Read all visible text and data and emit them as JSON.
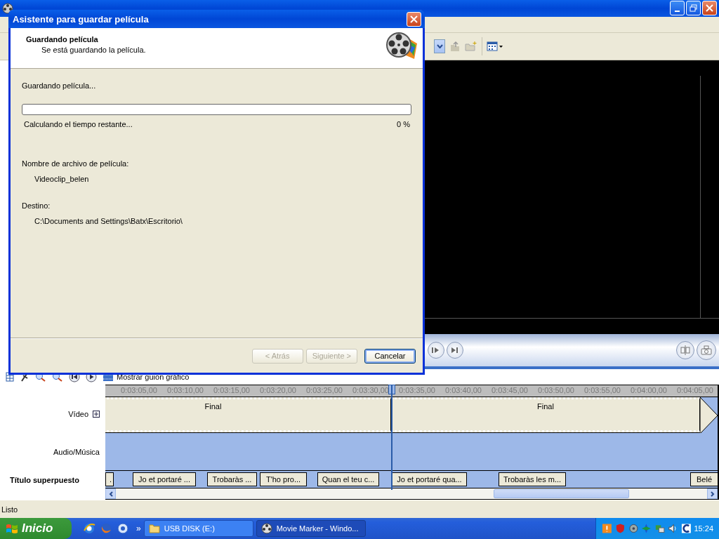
{
  "dialog": {
    "title": "Asistente para guardar película",
    "header": {
      "title": "Guardando película",
      "subtitle": "Se está guardando la película."
    },
    "progress_caption": "Guardando película...",
    "progress": {
      "level": 0
    },
    "status_text": "Calculando el tiempo restante...",
    "percent": "0 %",
    "fields": [
      {
        "label": "Nombre de archivo de película:",
        "value": "Videoclip_belen"
      },
      {
        "label": "Destino:",
        "value": "C:\\Documents and Settings\\Batx\\Escritorio\\"
      }
    ],
    "buttons": [
      {
        "label": "< Atrás",
        "disabled": true,
        "default": false
      },
      {
        "label": "Siguiente >",
        "disabled": true,
        "default": false
      },
      {
        "label": "Cancelar",
        "disabled": false,
        "default": true
      }
    ]
  },
  "timeline": {
    "toolbar_label": "Mostrar guion gráfico",
    "ruler": [
      "0:03:05,00",
      "0:03:10,00",
      "0:03:15,00",
      "0:03:20,00",
      "0:03:25,00",
      "0:03:30,00",
      "0:03:35,00",
      "0:03:40,00",
      "0:03:45,00",
      "0:03:50,00",
      "0:03:55,00",
      "0:04:00,00",
      "0:04:05,00"
    ],
    "tracks": [
      {
        "kind": "video",
        "label": "Vídeo",
        "clips": [
          "Final",
          "Final"
        ]
      },
      {
        "kind": "audio",
        "label": "Audio/Música"
      },
      {
        "kind": "title",
        "label": "Título superpuesto",
        "clips": [
          ".",
          "Jo et portaré ...",
          "Trobaràs ...",
          "T'ho pro...",
          "Quan el teu c...",
          "Jo et portaré qua...",
          "Trobaràs les m...",
          "Belé"
        ]
      }
    ]
  },
  "status_bar": "Listo",
  "taskbar": {
    "start": "Inicio",
    "more": "»",
    "tasks": [
      {
        "label": "USB DISK (E:)",
        "kind": "folder",
        "selected": false
      },
      {
        "label": "Movie Marker - Windo...",
        "kind": "app",
        "selected": true
      }
    ],
    "clock": "15:24"
  }
}
